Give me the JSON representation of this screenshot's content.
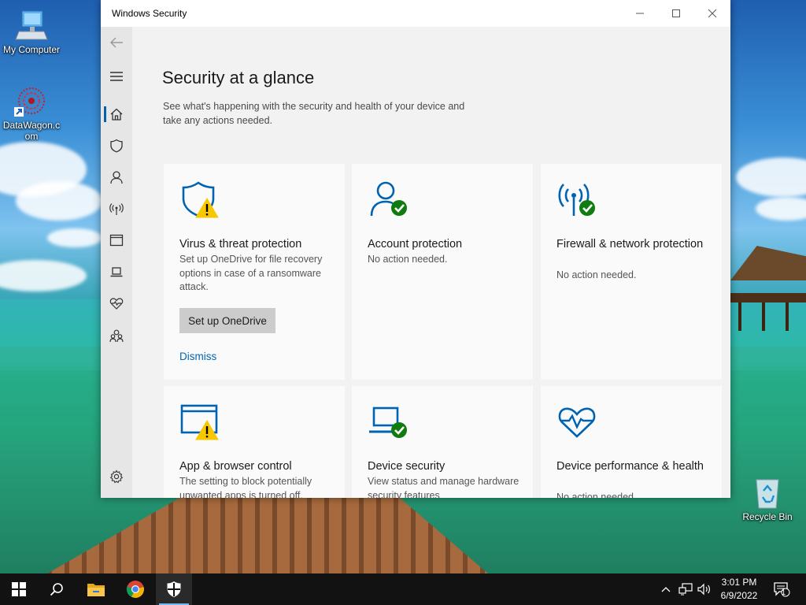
{
  "desktop": {
    "icons": [
      {
        "label": "My Computer"
      },
      {
        "label": "DataWagon.com"
      },
      {
        "label": "Recycle Bin"
      }
    ]
  },
  "window": {
    "title": "Windows Security",
    "page_title": "Security at a glance",
    "subtitle": "See what's happening with the security and health of your device and take any actions needed.",
    "cards": [
      {
        "icon": "shield-warning-icon",
        "title": "Virus & threat protection",
        "desc": "Set up OneDrive for file recovery options in case of a ransomware attack.",
        "button": "Set up OneDrive",
        "link": "Dismiss",
        "status": "warning"
      },
      {
        "icon": "account-check-icon",
        "title": "Account protection",
        "desc": "No action needed.",
        "status": "ok"
      },
      {
        "icon": "firewall-check-icon",
        "title": "Firewall & network protection",
        "desc": "No action needed.",
        "status": "ok"
      },
      {
        "icon": "app-browser-warning-icon",
        "title": "App & browser control",
        "desc": "The setting to block potentially unwanted apps is turned off.",
        "status": "warning"
      },
      {
        "icon": "device-security-check-icon",
        "title": "Device security",
        "desc": "View status and manage hardware security features",
        "status": "ok"
      },
      {
        "icon": "heart-pulse-icon",
        "title": "Device performance & health",
        "desc": "No action needed.",
        "status": "ok"
      }
    ],
    "sidebar": [
      "back-arrow-icon",
      "hamburger-icon",
      "home-icon",
      "shield-icon",
      "person-icon",
      "antenna-icon",
      "browser-window-icon",
      "laptop-icon",
      "heart-icon",
      "family-icon",
      "gear-icon"
    ]
  },
  "colors": {
    "accent": "#0063b1",
    "ok": "#107c10",
    "warning": "#f7c800",
    "link": "#0066b4"
  },
  "taskbar": {
    "items": [
      "windows-start-icon",
      "search-icon",
      "file-explorer-icon",
      "chrome-icon",
      "windows-security-icon"
    ],
    "time": "3:01 PM",
    "date": "6/9/2022",
    "notification_count": "1"
  }
}
